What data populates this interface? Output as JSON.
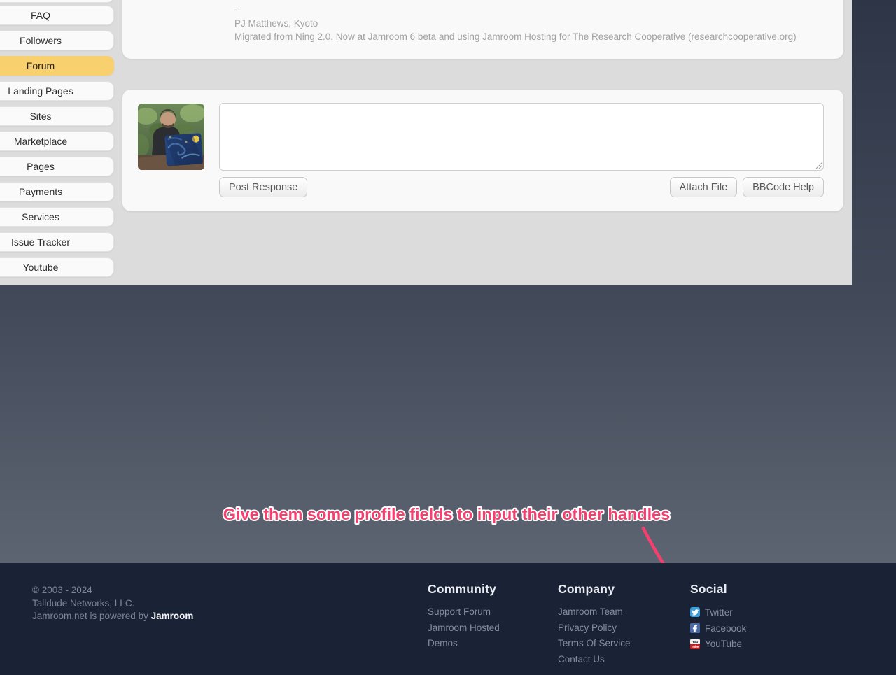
{
  "colors": {
    "accent": "#f8d06e",
    "annotation": "#f5406f",
    "twitter": "#3e9ed9",
    "facebook": "#4a69a5",
    "youtube": "#cc1d1d"
  },
  "sidebar": {
    "items": [
      {
        "label": "FAQ",
        "active": false
      },
      {
        "label": "Followers",
        "active": false
      },
      {
        "label": "Forum",
        "active": true
      },
      {
        "label": "Landing Pages",
        "active": false
      },
      {
        "label": "Sites",
        "active": false
      },
      {
        "label": "Marketplace",
        "active": false
      },
      {
        "label": "Pages",
        "active": false
      },
      {
        "label": "Payments",
        "active": false
      },
      {
        "label": "Services",
        "active": false
      },
      {
        "label": "Issue Tracker",
        "active": false
      },
      {
        "label": "Youtube",
        "active": false
      }
    ]
  },
  "post": {
    "signature_dashes": "--",
    "signature_name": "PJ Matthews, Kyoto",
    "signature_text": "Migrated from Ning 2.0. Now at Jamroom 6 beta and using Jamroom Hosting for The Research Cooperative (researchcooperative.org)"
  },
  "reply": {
    "textarea_value": "",
    "post_button": "Post Response",
    "attach_button": "Attach File",
    "bbcode_button": "BBCode Help"
  },
  "annotation": {
    "text": "Give them some profile fields to input their other handles"
  },
  "footer": {
    "copyright_line1": "© 2003 - 2024",
    "copyright_line2": "Talldude Networks, LLC.",
    "powered_by_prefix": "Jamroom.net is powered by ",
    "powered_by_brand": "Jamroom",
    "columns": [
      {
        "heading": "Community",
        "links": [
          "Support Forum",
          "Jamroom Hosted",
          "Demos"
        ]
      },
      {
        "heading": "Company",
        "links": [
          "Jamroom Team",
          "Privacy Policy",
          "Terms Of Service",
          "Contact Us"
        ]
      },
      {
        "heading": "Social",
        "links": [
          {
            "label": "Twitter",
            "icon": "twitter"
          },
          {
            "label": "Facebook",
            "icon": "facebook"
          },
          {
            "label": "YouTube",
            "icon": "youtube"
          }
        ]
      }
    ]
  }
}
